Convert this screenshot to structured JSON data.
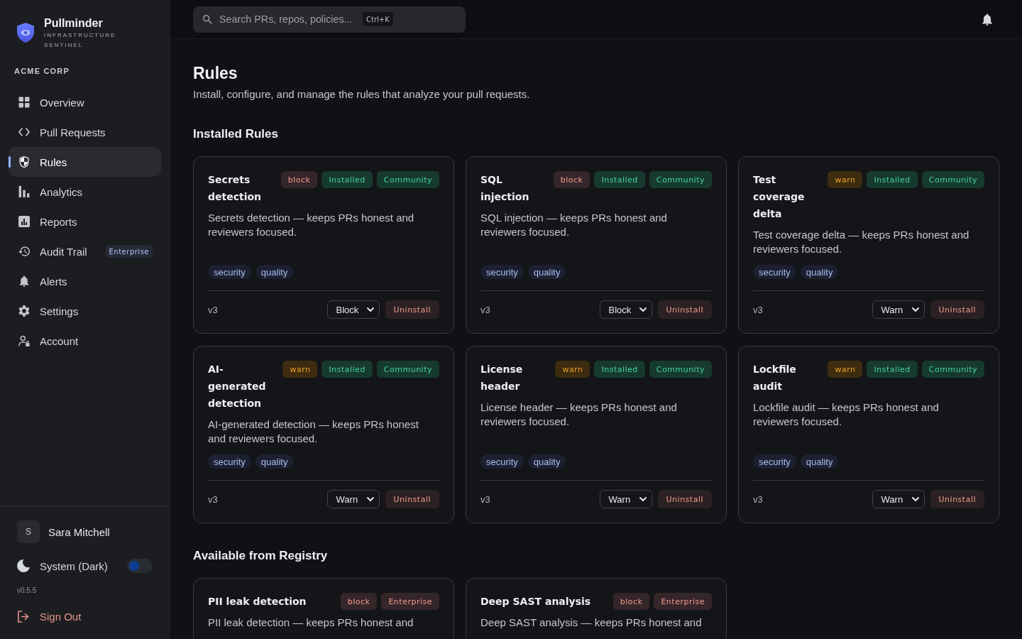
{
  "sidebar": {
    "brand": {
      "name": "Pullminder",
      "tagline": "INFRASTRUCTURE SENTINEL"
    },
    "org": "ACME CORP",
    "nav": [
      {
        "label": "Overview",
        "kind": "grid",
        "selected": false
      },
      {
        "label": "Pull Requests",
        "kind": "code",
        "selected": false
      },
      {
        "label": "Rules",
        "kind": "shield",
        "selected": true
      },
      {
        "label": "Analytics",
        "kind": "bars",
        "selected": false
      },
      {
        "label": "Reports",
        "kind": "report",
        "selected": false
      },
      {
        "label": "Audit Trail",
        "kind": "history",
        "selected": false,
        "badge": "Enterprise"
      },
      {
        "label": "Alerts",
        "kind": "bell",
        "selected": false
      },
      {
        "label": "Settings",
        "kind": "gear",
        "selected": false
      },
      {
        "label": "Account",
        "kind": "account",
        "selected": false
      }
    ],
    "user": {
      "initial": "S",
      "name": "Sara Mitchell"
    },
    "theme": {
      "label": "System (Dark)",
      "on": false
    },
    "version": "v0.5.5",
    "sign_out": "Sign Out"
  },
  "topbar": {
    "search": {
      "placeholder": "Search PRs, repos, policies...",
      "shortcut": "Ctrl+K"
    }
  },
  "page": {
    "title": "Rules",
    "subtitle": "Install, configure, and manage the rules that analyze your pull requests."
  },
  "sections": [
    {
      "title": "Installed Rules",
      "rules": [
        {
          "name": "Secrets detection",
          "badges": [
            {
              "label": "block",
              "kind": "danger"
            },
            {
              "label": "Installed",
              "kind": "success"
            },
            {
              "label": "Community",
              "kind": "success"
            }
          ],
          "description": "Secrets detection — keeps PRs honest and reviewers focused.",
          "tags": [
            "security",
            "quality"
          ],
          "version": "v3",
          "mode": "Block",
          "action": "Uninstall"
        },
        {
          "name": "SQL injection",
          "badges": [
            {
              "label": "block",
              "kind": "danger"
            },
            {
              "label": "Installed",
              "kind": "success"
            },
            {
              "label": "Community",
              "kind": "success"
            }
          ],
          "description": "SQL injection — keeps PRs honest and reviewers focused.",
          "tags": [
            "security",
            "quality"
          ],
          "version": "v3",
          "mode": "Block",
          "action": "Uninstall"
        },
        {
          "name": "Test coverage delta",
          "badges": [
            {
              "label": "warn",
              "kind": "warning"
            },
            {
              "label": "Installed",
              "kind": "success"
            },
            {
              "label": "Community",
              "kind": "success"
            }
          ],
          "description": "Test coverage delta — keeps PRs honest and reviewers focused.",
          "tags": [
            "security",
            "quality"
          ],
          "version": "v3",
          "mode": "Warn",
          "action": "Uninstall"
        },
        {
          "name": "AI-generated detection",
          "badges": [
            {
              "label": "warn",
              "kind": "warning"
            },
            {
              "label": "Installed",
              "kind": "success"
            },
            {
              "label": "Community",
              "kind": "success"
            }
          ],
          "description": "AI-generated detection — keeps PRs honest and reviewers focused.",
          "tags": [
            "security",
            "quality"
          ],
          "version": "v3",
          "mode": "Warn",
          "action": "Uninstall"
        },
        {
          "name": "License header",
          "badges": [
            {
              "label": "warn",
              "kind": "warning"
            },
            {
              "label": "Installed",
              "kind": "success"
            },
            {
              "label": "Community",
              "kind": "success"
            }
          ],
          "description": "License header — keeps PRs honest and reviewers focused.",
          "tags": [
            "security",
            "quality"
          ],
          "version": "v3",
          "mode": "Warn",
          "action": "Uninstall"
        },
        {
          "name": "Lockfile audit",
          "badges": [
            {
              "label": "warn",
              "kind": "warning"
            },
            {
              "label": "Installed",
              "kind": "success"
            },
            {
              "label": "Community",
              "kind": "success"
            }
          ],
          "description": "Lockfile audit — keeps PRs honest and reviewers focused.",
          "tags": [
            "security",
            "quality"
          ],
          "version": "v3",
          "mode": "Warn",
          "action": "Uninstall"
        }
      ]
    },
    {
      "title": "Available from Registry",
      "rules": [
        {
          "name": "PII leak detection",
          "badges": [
            {
              "label": "block",
              "kind": "danger"
            },
            {
              "label": "Enterprise",
              "kind": "danger"
            }
          ],
          "description": "PII leak detection — keeps PRs honest and"
        },
        {
          "name": "Deep SAST analysis",
          "badges": [
            {
              "label": "block",
              "kind": "danger"
            },
            {
              "label": "Enterprise",
              "kind": "danger"
            }
          ],
          "description": "Deep SAST analysis — keeps PRs honest and"
        }
      ]
    }
  ]
}
